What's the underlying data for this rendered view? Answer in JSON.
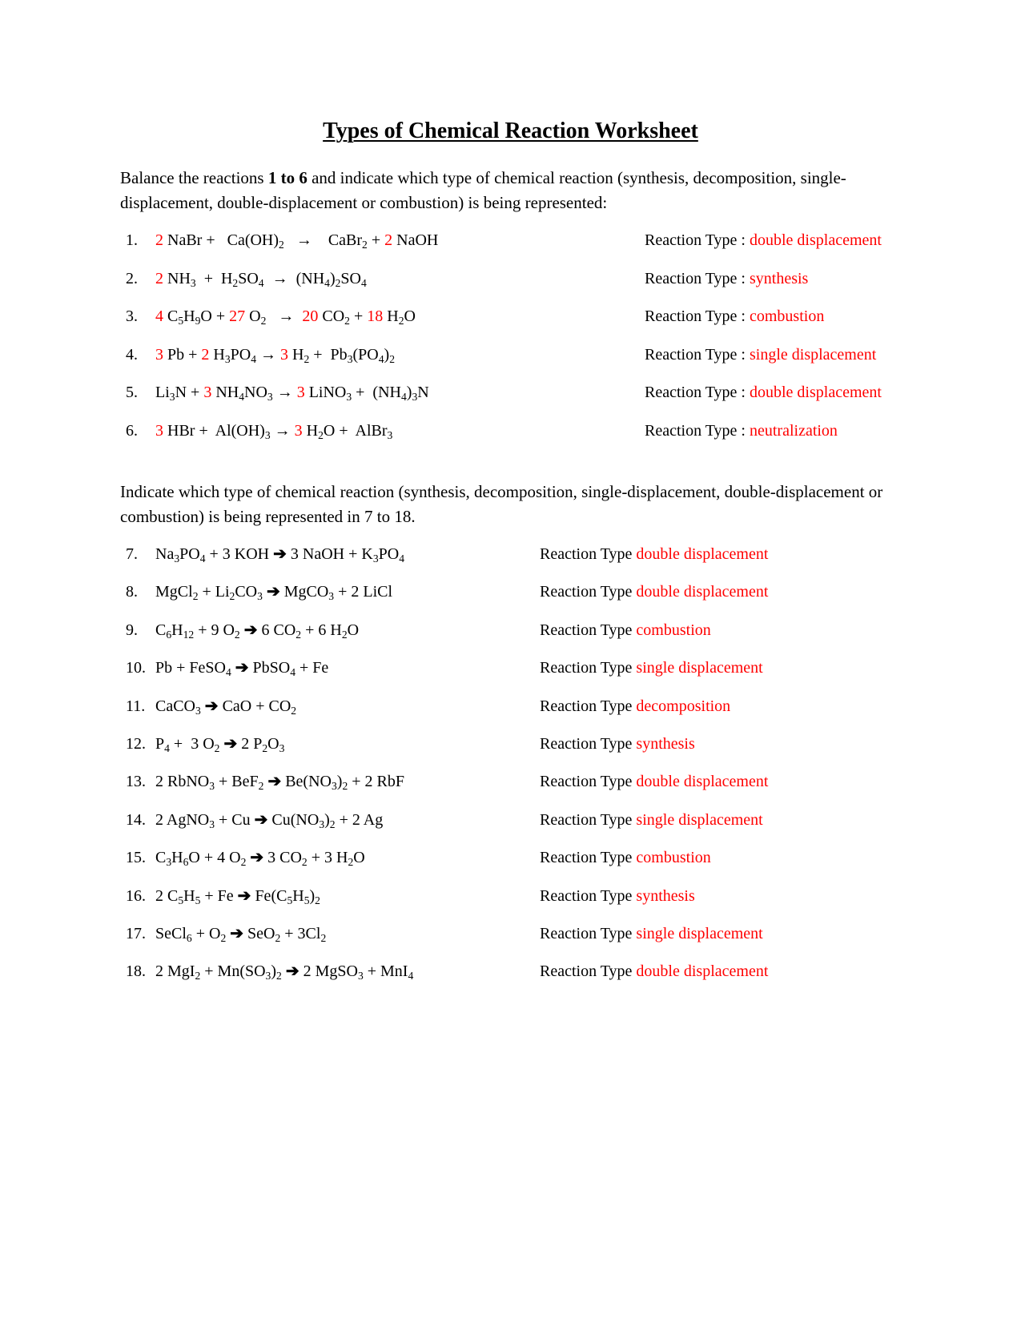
{
  "title": "Types of Chemical Reaction Worksheet",
  "section1": {
    "intro_parts": [
      {
        "text": "Balance the reactions ",
        "bold": false
      },
      {
        "text": "1 to 6",
        "bold": true
      },
      {
        "text": " and indicate which type of chemical reaction (synthesis, decomposition, single-displacement, double-displacement or combustion) is being represented:",
        "bold": false
      }
    ],
    "reaction_type_label": "Reaction Type : ",
    "items": [
      {
        "number": "1.",
        "type": "double displacement",
        "arrow": "thin",
        "tokens": [
          {
            "t": "2",
            "c": "red"
          },
          {
            "t": " NaBr +   Ca(OH)"
          },
          {
            "sub": "2"
          },
          {
            "t": "   "
          },
          {
            "arrow": true
          },
          {
            "t": "    CaBr"
          },
          {
            "sub": "2"
          },
          {
            "t": " + "
          },
          {
            "t": "2",
            "c": "red"
          },
          {
            "t": " NaOH"
          }
        ]
      },
      {
        "number": "2.",
        "type": "synthesis",
        "arrow": "thin",
        "tokens": [
          {
            "t": "2",
            "c": "red"
          },
          {
            "t": " NH"
          },
          {
            "sub": "3"
          },
          {
            "t": "  +  H"
          },
          {
            "sub": "2"
          },
          {
            "t": "SO"
          },
          {
            "sub": "4"
          },
          {
            "t": "  "
          },
          {
            "arrow": true
          },
          {
            "t": "  (NH"
          },
          {
            "sub": "4"
          },
          {
            "t": ")"
          },
          {
            "sub": "2"
          },
          {
            "t": "SO"
          },
          {
            "sub": "4"
          }
        ]
      },
      {
        "number": "3.",
        "type": "combustion",
        "arrow": "thin",
        "tokens": [
          {
            "t": "4",
            "c": "red"
          },
          {
            "t": " C"
          },
          {
            "sub": "5"
          },
          {
            "t": "H"
          },
          {
            "sub": "9"
          },
          {
            "t": "O + "
          },
          {
            "t": "27",
            "c": "red"
          },
          {
            "t": " O"
          },
          {
            "sub": "2"
          },
          {
            "t": "   "
          },
          {
            "arrow": true
          },
          {
            "t": "  "
          },
          {
            "t": "20",
            "c": "red"
          },
          {
            "t": " CO"
          },
          {
            "sub": "2"
          },
          {
            "t": " + "
          },
          {
            "t": "18",
            "c": "red"
          },
          {
            "t": " H"
          },
          {
            "sub": "2"
          },
          {
            "t": "O"
          }
        ]
      },
      {
        "number": "4.",
        "type": "single displacement",
        "arrow": "thin",
        "tokens": [
          {
            "t": "3",
            "c": "red"
          },
          {
            "t": " Pb + "
          },
          {
            "t": "2",
            "c": "red"
          },
          {
            "t": " H"
          },
          {
            "sub": "3"
          },
          {
            "t": "PO"
          },
          {
            "sub": "4"
          },
          {
            "t": " "
          },
          {
            "arrow": true
          },
          {
            "t": " "
          },
          {
            "t": "3",
            "c": "red"
          },
          {
            "t": " H"
          },
          {
            "sub": "2"
          },
          {
            "t": " +  Pb"
          },
          {
            "sub": "3"
          },
          {
            "t": "(PO"
          },
          {
            "sub": "4"
          },
          {
            "t": ")"
          },
          {
            "sub": "2"
          }
        ]
      },
      {
        "number": "5.",
        "type": "double displacement",
        "arrow": "thin",
        "tokens": [
          {
            "t": "Li"
          },
          {
            "sub": "3"
          },
          {
            "t": "N + "
          },
          {
            "t": "3",
            "c": "red"
          },
          {
            "t": " NH"
          },
          {
            "sub": "4"
          },
          {
            "t": "NO"
          },
          {
            "sub": "3"
          },
          {
            "t": " "
          },
          {
            "arrow": true
          },
          {
            "t": " "
          },
          {
            "t": "3",
            "c": "red"
          },
          {
            "t": " LiNO"
          },
          {
            "sub": "3"
          },
          {
            "t": " +  (NH"
          },
          {
            "sub": "4"
          },
          {
            "t": ")"
          },
          {
            "sub": "3"
          },
          {
            "t": "N"
          }
        ]
      },
      {
        "number": "6.",
        "type": "neutralization",
        "arrow": "thin",
        "tokens": [
          {
            "t": "3",
            "c": "red"
          },
          {
            "t": " HBr +  Al(OH)"
          },
          {
            "sub": "3"
          },
          {
            "t": " "
          },
          {
            "arrow": true
          },
          {
            "t": " "
          },
          {
            "t": "3",
            "c": "red"
          },
          {
            "t": " H"
          },
          {
            "sub": "2"
          },
          {
            "t": "O +  AlBr"
          },
          {
            "sub": "3"
          }
        ]
      }
    ]
  },
  "section2": {
    "intro": "Indicate which type of chemical reaction (synthesis, decomposition, single-displacement, double-displacement or combustion) is being represented in 7 to 18.",
    "reaction_type_label": "Reaction Type ",
    "items": [
      {
        "number": "7.",
        "type": "double displacement",
        "arrow": "bold",
        "tokens": [
          {
            "t": "Na"
          },
          {
            "sub": "3"
          },
          {
            "t": "PO"
          },
          {
            "sub": "4"
          },
          {
            "t": " + 3 KOH "
          },
          {
            "arrow": true
          },
          {
            "t": " 3 NaOH + K"
          },
          {
            "sub": "3"
          },
          {
            "t": "PO"
          },
          {
            "sub": "4"
          }
        ]
      },
      {
        "number": "8.",
        "type": "double displacement",
        "arrow": "bold",
        "tokens": [
          {
            "t": "MgCl"
          },
          {
            "sub": "2"
          },
          {
            "t": " + Li"
          },
          {
            "sub": "2"
          },
          {
            "t": "CO"
          },
          {
            "sub": "3"
          },
          {
            "t": " "
          },
          {
            "arrow": true
          },
          {
            "t": " MgCO"
          },
          {
            "sub": "3"
          },
          {
            "t": " + 2 LiCl"
          }
        ]
      },
      {
        "number": "9.",
        "type": "combustion",
        "arrow": "bold",
        "tokens": [
          {
            "t": "C"
          },
          {
            "sub": "6"
          },
          {
            "t": "H"
          },
          {
            "sub": "12"
          },
          {
            "t": " + 9 O"
          },
          {
            "sub": "2"
          },
          {
            "t": " "
          },
          {
            "arrow": true
          },
          {
            "t": " 6 CO"
          },
          {
            "sub": "2"
          },
          {
            "t": " + 6 H"
          },
          {
            "sub": "2"
          },
          {
            "t": "O"
          }
        ]
      },
      {
        "number": "10.",
        "type": "single displacement",
        "arrow": "bold",
        "tokens": [
          {
            "t": "Pb + FeSO"
          },
          {
            "sub": "4"
          },
          {
            "t": " "
          },
          {
            "arrow": true
          },
          {
            "t": " PbSO"
          },
          {
            "sub": "4"
          },
          {
            "t": " + Fe"
          }
        ]
      },
      {
        "number": "11.",
        "type": "decomposition",
        "arrow": "bold",
        "tokens": [
          {
            "t": "CaCO"
          },
          {
            "sub": "3"
          },
          {
            "t": " "
          },
          {
            "arrow": true
          },
          {
            "t": " CaO + CO"
          },
          {
            "sub": "2"
          }
        ]
      },
      {
        "number": "12.",
        "type": "synthesis",
        "arrow": "bold",
        "tokens": [
          {
            "t": "P"
          },
          {
            "sub": "4"
          },
          {
            "t": " +  3 O"
          },
          {
            "sub": "2"
          },
          {
            "t": " "
          },
          {
            "arrow": true
          },
          {
            "t": " 2 P"
          },
          {
            "sub": "2"
          },
          {
            "t": "O"
          },
          {
            "sub": "3"
          }
        ]
      },
      {
        "number": "13.",
        "type": "double displacement",
        "arrow": "bold",
        "tokens": [
          {
            "t": "2 RbNO"
          },
          {
            "sub": "3"
          },
          {
            "t": " + BeF"
          },
          {
            "sub": "2"
          },
          {
            "t": " "
          },
          {
            "arrow": true
          },
          {
            "t": " Be(NO"
          },
          {
            "sub": "3"
          },
          {
            "t": ")"
          },
          {
            "sub": "2"
          },
          {
            "t": " + 2 RbF"
          }
        ]
      },
      {
        "number": "14.",
        "type": "single displacement",
        "arrow": "bold",
        "tokens": [
          {
            "t": "2 AgNO"
          },
          {
            "sub": "3"
          },
          {
            "t": " + Cu "
          },
          {
            "arrow": true
          },
          {
            "t": " Cu(NO"
          },
          {
            "sub": "3"
          },
          {
            "t": ")"
          },
          {
            "sub": "2"
          },
          {
            "t": " + 2 Ag"
          }
        ]
      },
      {
        "number": "15.",
        "type": "combustion",
        "arrow": "bold",
        "tokens": [
          {
            "t": "C"
          },
          {
            "sub": "3"
          },
          {
            "t": "H"
          },
          {
            "sub": "6"
          },
          {
            "t": "O + 4 O"
          },
          {
            "sub": "2"
          },
          {
            "t": " "
          },
          {
            "arrow": true
          },
          {
            "t": " 3 CO"
          },
          {
            "sub": "2"
          },
          {
            "t": " + 3 H"
          },
          {
            "sub": "2"
          },
          {
            "t": "O"
          }
        ]
      },
      {
        "number": "16.",
        "type": "synthesis",
        "arrow": "bold",
        "tokens": [
          {
            "t": "2 C"
          },
          {
            "sub": "5"
          },
          {
            "t": "H"
          },
          {
            "sub": "5"
          },
          {
            "t": " + Fe "
          },
          {
            "arrow": true
          },
          {
            "t": " Fe(C"
          },
          {
            "sub": "5"
          },
          {
            "t": "H"
          },
          {
            "sub": "5"
          },
          {
            "t": ")"
          },
          {
            "sub": "2"
          }
        ]
      },
      {
        "number": "17.",
        "type": "single displacement",
        "arrow": "bold",
        "tokens": [
          {
            "t": "SeCl"
          },
          {
            "sub": "6"
          },
          {
            "t": " + O"
          },
          {
            "sub": "2"
          },
          {
            "t": " "
          },
          {
            "arrow": true
          },
          {
            "t": " SeO"
          },
          {
            "sub": "2"
          },
          {
            "t": " + 3Cl"
          },
          {
            "sub": "2"
          }
        ]
      },
      {
        "number": "18.",
        "type": "double displacement",
        "arrow": "bold",
        "tokens": [
          {
            "t": "2 MgI"
          },
          {
            "sub": "2"
          },
          {
            "t": " + Mn(SO"
          },
          {
            "sub": "3"
          },
          {
            "t": ")"
          },
          {
            "sub": "2"
          },
          {
            "t": " "
          },
          {
            "arrow": true
          },
          {
            "t": " 2 MgSO"
          },
          {
            "sub": "3"
          },
          {
            "t": " + MnI"
          },
          {
            "sub": "4"
          }
        ]
      }
    ]
  },
  "icons": {
    "thin_arrow": "→",
    "bold_arrow": "➔"
  },
  "colors": {
    "answer": "#ff0000",
    "text": "#000000"
  }
}
